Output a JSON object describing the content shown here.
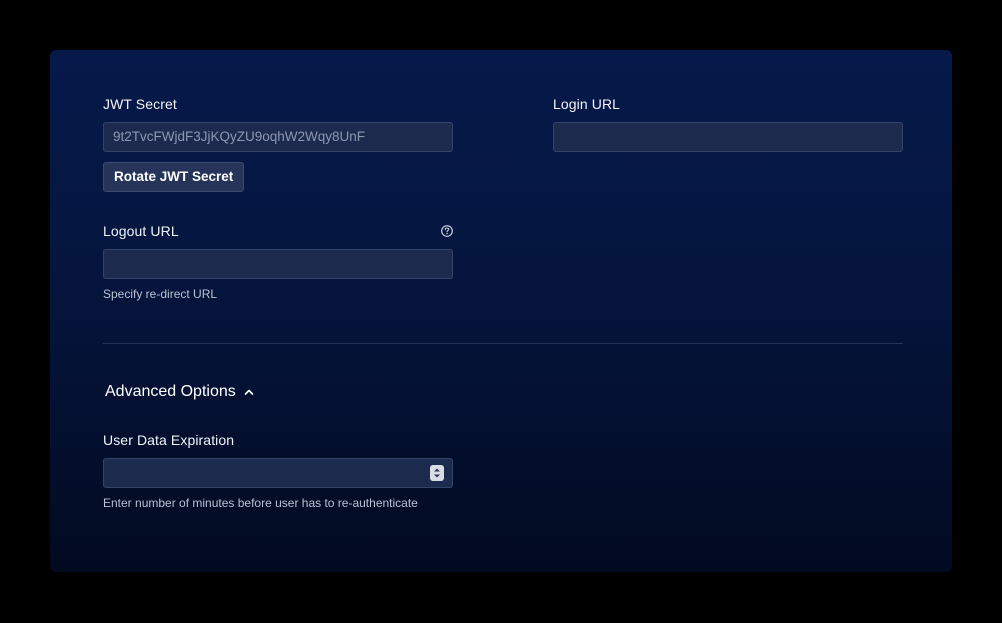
{
  "jwt": {
    "label": "JWT Secret",
    "value": "9t2TvcFWjdF3JjKQyZU9oqhW2Wqy8UnF",
    "rotate_button": "Rotate JWT Secret"
  },
  "login": {
    "label": "Login URL",
    "value": ""
  },
  "logout": {
    "label": "Logout URL",
    "value": "",
    "help": "Specify re-direct URL",
    "info_icon": "question-circle-icon"
  },
  "advanced": {
    "title": "Advanced Options",
    "toggle_icon": "chevron-up-icon"
  },
  "expiration": {
    "label": "User Data Expiration",
    "value": "",
    "help": "Enter number of minutes before user has to re-authenticate",
    "stepper_icon": "stepper-icon"
  },
  "colors": {
    "panel_top": "#06194a",
    "panel_bottom": "#020a20",
    "input_bg": "#1c2a4e",
    "button_bg": "#27345a"
  }
}
